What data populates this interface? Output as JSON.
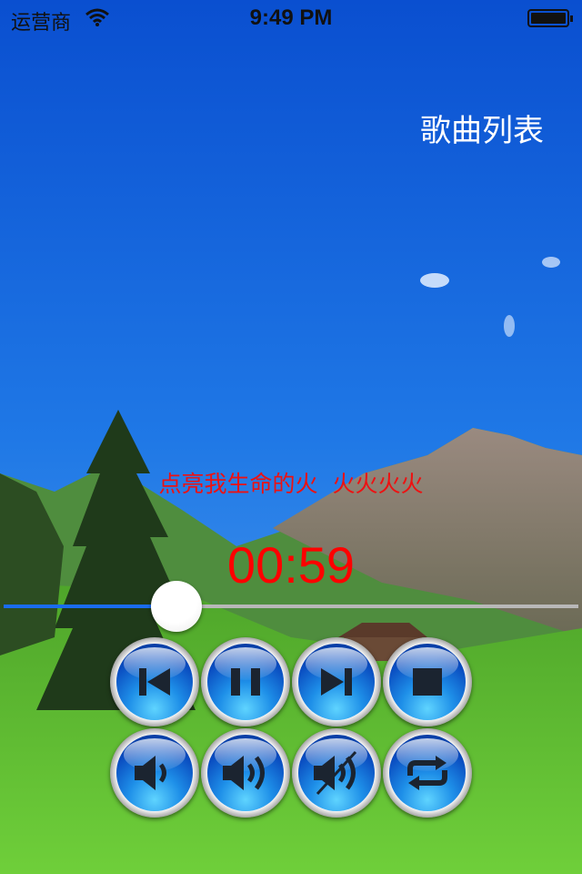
{
  "status_bar": {
    "carrier": "运营商",
    "time": "9:49 PM"
  },
  "header": {
    "playlist_label": "歌曲列表"
  },
  "now_playing": {
    "lyric": "点亮我生命的火  火火火火",
    "elapsed": "00:59"
  },
  "progress": {
    "fraction": 0.3
  },
  "controls": [
    {
      "icon": "previous-track-icon"
    },
    {
      "icon": "pause-icon"
    },
    {
      "icon": "next-track-icon"
    },
    {
      "icon": "stop-icon"
    },
    {
      "icon": "volume-down-icon"
    },
    {
      "icon": "volume-up-icon"
    },
    {
      "icon": "mute-icon"
    },
    {
      "icon": "repeat-icon"
    }
  ],
  "colors": {
    "lyric": "#ee1111",
    "time": "#ff0000",
    "progress_fill": "#1a6cf0",
    "button": "#1e8fe8"
  }
}
